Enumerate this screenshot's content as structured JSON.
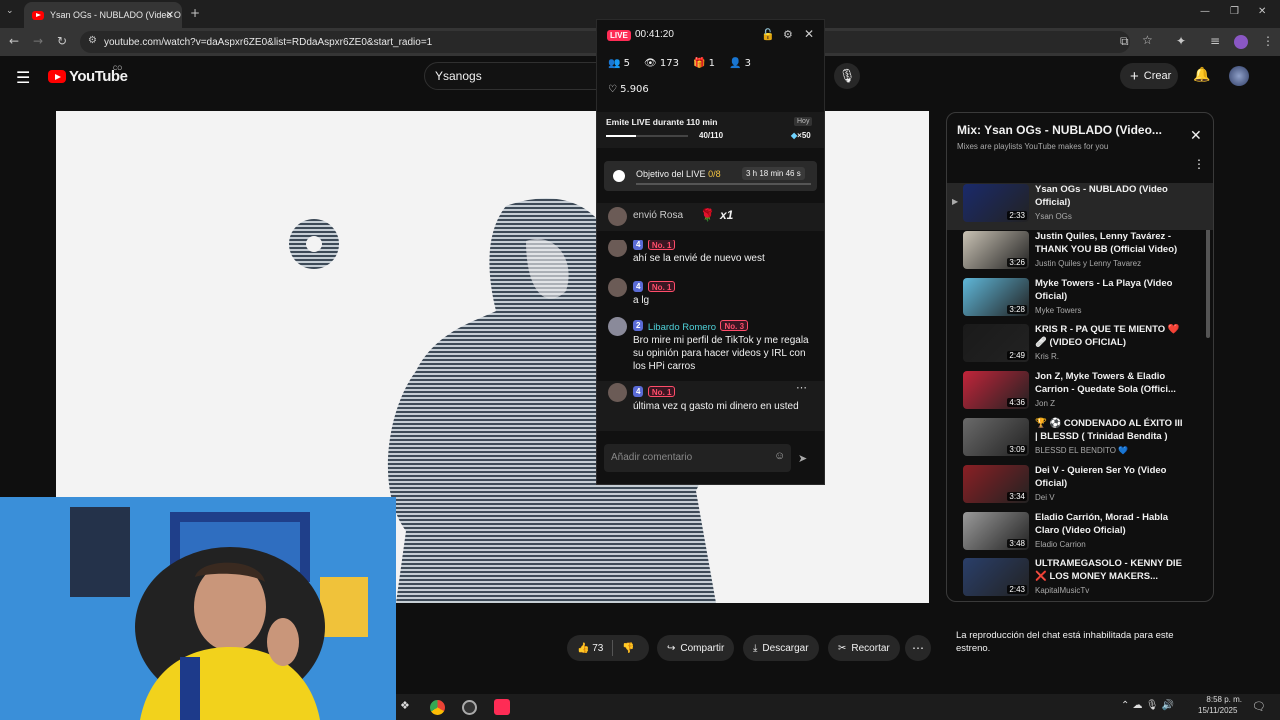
{
  "browser": {
    "tab_title": "Ysan OGs - NUBLADO (Video O",
    "url": "youtube.com/watch?v=daAspxr6ZE0&list=RDdaAspxr6ZE0&start_radio=1"
  },
  "youtube": {
    "logo_text": "YouTube",
    "logo_region": "CO",
    "search_value": "Ysanogs",
    "create_label": "Crear"
  },
  "tiktok": {
    "live_badge": "LIVE",
    "timer": "00:41:20",
    "stats": {
      "guests": "5",
      "viewers": "173",
      "gifts": "1",
      "members": "3",
      "likes": "5.906"
    },
    "mission_label": "Emite LIVE durante 110 min",
    "mission_progress_text": "40/110",
    "mission_progress": 0.364,
    "mission_day": "Hoy",
    "mission_reward": "×50",
    "goal_label": "Objetivo del LIVE",
    "goal_count": "0/8",
    "goal_time": "3 h 18 min 46 s",
    "gift_text": "envió Rosa",
    "gift_count": "x1",
    "messages": [
      {
        "level": "4",
        "rank": "No. 1",
        "name": "",
        "text": "ahí se la envié de nuevo west"
      },
      {
        "level": "4",
        "rank": "No. 1",
        "name": "",
        "text": "a lg"
      },
      {
        "level": "2",
        "rank": "No. 3",
        "name": "Libardo Romero",
        "text": "Bro mire mi perfil de TikTok y me regala su opinión para hacer videos y IRL con los HPi carros"
      },
      {
        "level": "4",
        "rank": "No. 1",
        "name": "",
        "text": "última vez q gasto mi dinero en usted"
      }
    ],
    "comment_placeholder": "Añadir comentario"
  },
  "actions": {
    "likes": "73",
    "share": "Compartir",
    "download": "Descargar",
    "clip": "Recortar"
  },
  "playlist": {
    "title": "Mix: Ysan OGs - NUBLADO (Video...",
    "subtitle": "Mixes are playlists YouTube makes for you",
    "items": [
      {
        "title": "Ysan OGs - NUBLADO (Video Official)",
        "channel": "Ysan OGs",
        "duration": "2:33",
        "color": "#1a2a6b"
      },
      {
        "title": "Justin Quiles, Lenny Tavárez - THANK YOU BB (Official Video)",
        "channel": "Justin Quiles y Lenny Tavarez",
        "duration": "3:26",
        "color": "#c9c2b4"
      },
      {
        "title": "Myke Towers - La Playa (Video Oficial)",
        "channel": "Myke Towers",
        "duration": "3:28",
        "color": "#5fb7d9"
      },
      {
        "title": "KRIS R - PA QUE TE MIENTO ❤️🩹 (VIDEO OFICIAL)",
        "channel": "Kris R.",
        "duration": "2:49",
        "color": "#1a1a1a"
      },
      {
        "title": "Jon Z, Myke Towers & Eladio Carrion - Quedate Sola (Offici...",
        "channel": "Jon Z",
        "duration": "4:36",
        "color": "#c2243a"
      },
      {
        "title": "🏆 ⚽ CONDENADO AL ÉXITO III | BLESSD ( Trinidad Bendita )",
        "channel": "BLESSD EL BENDITO 💙",
        "duration": "3:09",
        "color": "#6a6a6a"
      },
      {
        "title": "Dei V - Quieren Ser Yo (Video Oficial)",
        "channel": "Dei V",
        "duration": "3:34",
        "color": "#8a1f24"
      },
      {
        "title": "Eladio Carrión, Morad - Habla Claro (Video Oficial)",
        "channel": "Eladio Carrion",
        "duration": "3:48",
        "color": "#9a9a9a"
      },
      {
        "title": "ULTRAMEGASOLO - KENNY DIE ❌ LOS MONEY MAKERS...",
        "channel": "KapitalMusicTv",
        "duration": "2:43",
        "color": "#2a3f6a"
      }
    ]
  },
  "chat_disabled": "La reproducción del chat está inhabilitada para este estreno.",
  "taskbar": {
    "time": "8:58 p. m.",
    "date": "15/11/2025"
  }
}
